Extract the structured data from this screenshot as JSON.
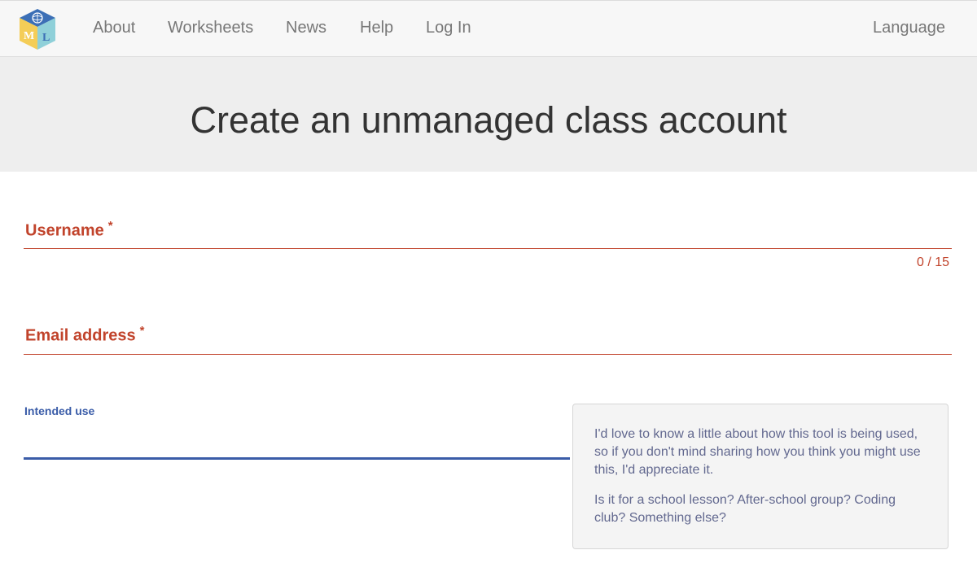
{
  "nav": {
    "logo_letters": "ML",
    "items": [
      {
        "label": "About"
      },
      {
        "label": "Worksheets"
      },
      {
        "label": "News"
      },
      {
        "label": "Help"
      },
      {
        "label": "Log In"
      }
    ],
    "language_label": "Language"
  },
  "page": {
    "title": "Create an unmanaged class account"
  },
  "form": {
    "username": {
      "label": "Username",
      "required_marker": "*",
      "value": "",
      "counter": "0 / 15"
    },
    "email": {
      "label": "Email address",
      "required_marker": "*",
      "value": ""
    },
    "intended_use": {
      "label": "Intended use",
      "value": ""
    },
    "help": {
      "paragraphs": [
        "I'd love to know a little about how this tool is being used, so if you don't mind sharing how you think you might use this, I'd appreciate it.",
        "Is it for a school lesson? After-school group? Coding club? Something else?"
      ]
    }
  },
  "colors": {
    "accent_red": "#c1432b",
    "accent_blue": "#3a5ca8",
    "help_text": "#62688f"
  }
}
